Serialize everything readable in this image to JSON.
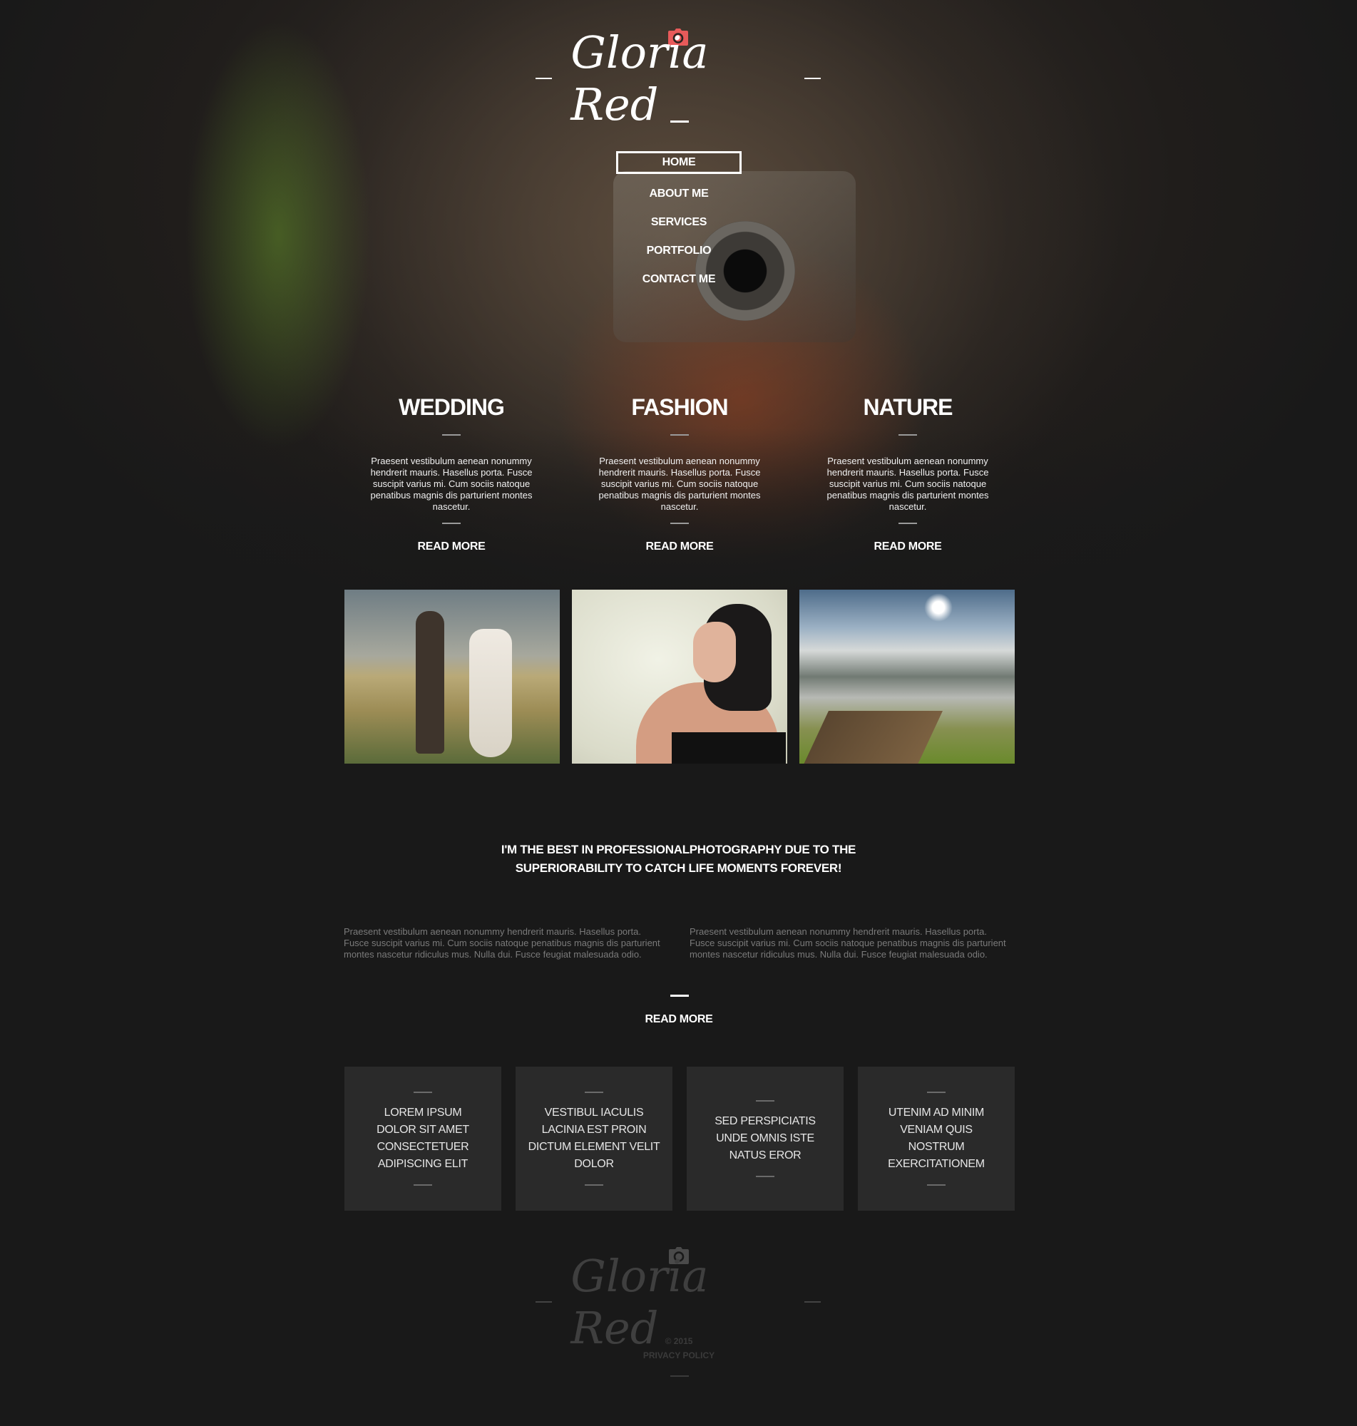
{
  "colors": {
    "accent": "#e85a5a",
    "background": "#191919",
    "tile": "#2a2a2a"
  },
  "header": {
    "logo_icon": "camera-icon",
    "brand": "Gloria Red"
  },
  "nav": {
    "items": [
      {
        "label": "HOME",
        "active": true
      },
      {
        "label": "ABOUT ME"
      },
      {
        "label": "SERVICES"
      },
      {
        "label": "PORTFOLIO"
      },
      {
        "label": "CONTACT ME"
      }
    ]
  },
  "features": [
    {
      "title": "WEDDING",
      "text": "Praesent vestibulum aenean nonummy hendrerit mauris. Hasellus porta. Fusce suscipit varius mi. Cum sociis natoque penatibus magnis dis parturient montes nascetur.",
      "read_more": "READ MORE",
      "image": "wedding-photo"
    },
    {
      "title": "FASHION",
      "text": "Praesent vestibulum aenean nonummy hendrerit mauris. Hasellus porta. Fusce suscipit varius mi. Cum sociis natoque penatibus magnis dis parturient montes nascetur.",
      "read_more": "READ MORE",
      "image": "fashion-photo"
    },
    {
      "title": "NATURE",
      "text": "Praesent vestibulum aenean nonummy hendrerit mauris. Hasellus porta. Fusce suscipit varius mi. Cum sociis natoque penatibus magnis dis parturient montes nascetur.",
      "read_more": "READ MORE",
      "image": "nature-photo"
    }
  ],
  "about": {
    "title": "I'M THE BEST IN PROFESSIONALPHOTOGRAPHY DUE TO THE SUPERIORABILITY TO CATCH LIFE MOMENTS FOREVER!",
    "col1": "Praesent vestibulum aenean nonummy hendrerit mauris. Hasellus porta. Fusce suscipit varius mi. Cum sociis natoque penatibus magnis dis parturient montes nascetur  ridiculus mus. Nulla dui. Fusce feugiat malesuada odio.",
    "col2": "Praesent vestibulum aenean nonummy hendrerit mauris. Hasellus porta. Fusce suscipit varius mi. Cum sociis natoque penatibus magnis dis parturient montes nascetur  ridiculus mus. Nulla dui. Fusce feugiat malesuada odio.",
    "read_more": "READ MORE"
  },
  "tiles": [
    {
      "label": "LOREM IPSUM\nDOLOR SIT AMET\nCONSECTETUER\nADIPISCING ELIT"
    },
    {
      "label": "VESTIBUL IACULIS\nLACINIA EST PROIN\nDICTUM ELEMENT VELIT\nDOLOR"
    },
    {
      "label": "SED PERSPICIATIS\nUNDE OMNIS ISTE\nNATUS EROR"
    },
    {
      "label": "UTENIM AD MINIM\nVENIAM QUIS\nNOSTRUM\nEXERCITATIONEM"
    }
  ],
  "footer": {
    "icon": "camera-icon",
    "brand": "Gloria Red",
    "copyright": "© 2015",
    "privacy": "PRIVACY POLICY"
  }
}
